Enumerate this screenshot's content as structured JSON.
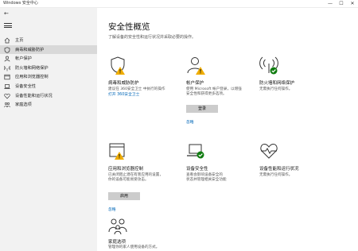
{
  "window": {
    "title": "Windows 安全中心",
    "minimize": "—",
    "maximize": "☐",
    "close": "✕"
  },
  "sidebar": {
    "items": [
      {
        "label": "主页",
        "icon": "home-icon",
        "active": false
      },
      {
        "label": "病毒和威胁防护",
        "icon": "shield-icon",
        "active": true
      },
      {
        "label": "帐户保护",
        "icon": "person-icon",
        "active": false
      },
      {
        "label": "防火墙和网络保护",
        "icon": "wifi-icon",
        "active": false
      },
      {
        "label": "应用和浏览器控制",
        "icon": "browser-icon",
        "active": false
      },
      {
        "label": "设备安全性",
        "icon": "laptop-icon",
        "active": false
      },
      {
        "label": "设备性能和运行状况",
        "icon": "heart-icon",
        "active": false
      },
      {
        "label": "家庭选项",
        "icon": "family-icon",
        "active": false
      }
    ]
  },
  "main": {
    "title": "安全性概览",
    "description": "了解设备的安全性和运行状况并采取必要的操作。",
    "cards": [
      {
        "title": "病毒和威胁防护",
        "desc1": "建议在 360安全卫士 中执行的操作",
        "desc2": "",
        "link": "打开 360安全卫士",
        "button": "",
        "icon": "shield-warning-icon"
      },
      {
        "title": "帐户保护",
        "desc1": "使用 Microsoft 帐户登录，以增强",
        "desc2": "安全性和获得更多选项。",
        "link": "忽略",
        "button": "登录",
        "icon": "person-warning-icon"
      },
      {
        "title": "防火墙和网络保护",
        "desc1": "无需执行任何操作。",
        "desc2": "",
        "link": "",
        "button": "",
        "icon": "wifi-ok-icon"
      },
      {
        "title": "应用和浏览器控制",
        "desc1": "已关闭阻止潜在有害应用的设置，",
        "desc2": "你的设备可能易受攻击。",
        "link": "忽略",
        "button": "启用",
        "icon": "browser-warning-icon"
      },
      {
        "title": "设备安全性",
        "desc1": "查看会影响设备安全的",
        "desc2": "状态并管理相关安全功能",
        "link": "",
        "button": "",
        "icon": "laptop-ok-icon"
      },
      {
        "title": "设备性能和运行状况",
        "desc1": "无需执行任何操作。",
        "desc2": "",
        "link": "",
        "button": "",
        "icon": "heart-pulse-icon"
      },
      {
        "title": "家庭选项",
        "desc1": "管理你的家人使用设备的方式。",
        "desc2": "",
        "link": "",
        "button": "",
        "icon": "family-icon"
      }
    ]
  },
  "colors": {
    "accent": "#0067b8",
    "warning": "#f0ad00",
    "ok": "#107c10",
    "sidebar": "#f2f2f2",
    "active": "#d9d9d9"
  }
}
